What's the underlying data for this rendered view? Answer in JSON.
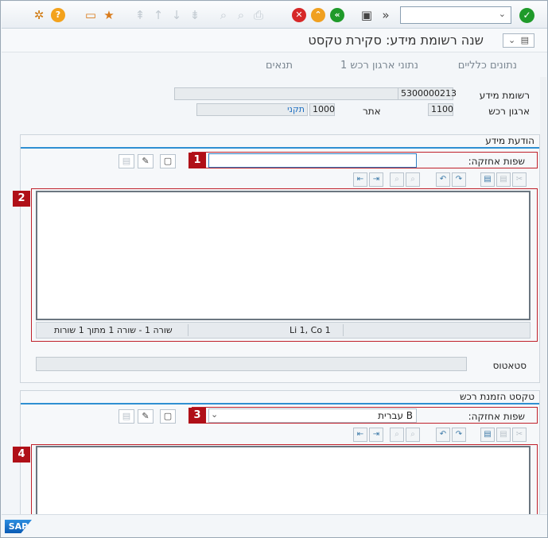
{
  "toolbar": {
    "command_field_value": "",
    "icons": [
      "settings-icon",
      "help-icon",
      "layout-icon",
      "favorites-icon",
      "first-page-icon",
      "prev-page-icon",
      "next-page-icon",
      "last-page-icon",
      "find-icon",
      "find-next-icon",
      "print-icon",
      "cancel-icon",
      "exit-icon",
      "back-icon",
      "save-icon",
      "expand-icon",
      "confirm-icon"
    ]
  },
  "window": {
    "title": "שנה רשומת מידע: סקירת טקסט"
  },
  "tabs": [
    "נתונים כלליים",
    "נתוני ארגון רכש 1",
    "תנאים"
  ],
  "header": {
    "info_record_label": "רשומת מידע",
    "info_record_value": "5300000213",
    "purch_org_label": "ארגון רכש",
    "purch_org_value": "1100",
    "plant_label": "אתר",
    "plant_value": "1000",
    "type_value": "תקני"
  },
  "info_memo": {
    "title": "הודעת מידע",
    "lang_label": "שפות אחזקה:",
    "lang_value": "",
    "badge_lang": "1",
    "badge_editor": "2",
    "status_pos": "Li 1, Co 1",
    "status_lines": "שורה 1 - שורה 1 מתוך 1 שורות"
  },
  "status": {
    "label": "סטאטוס",
    "value": ""
  },
  "po_text": {
    "title": "טקסט הזמנת רכש",
    "lang_label": "שפות אחזקה:",
    "lang_value": "B עברית",
    "badge_lang": "3",
    "badge_editor": "4"
  },
  "footer": {
    "logo": "SAP"
  },
  "colors": {
    "accent": "#2f8fd2",
    "callout": "#b01018"
  }
}
